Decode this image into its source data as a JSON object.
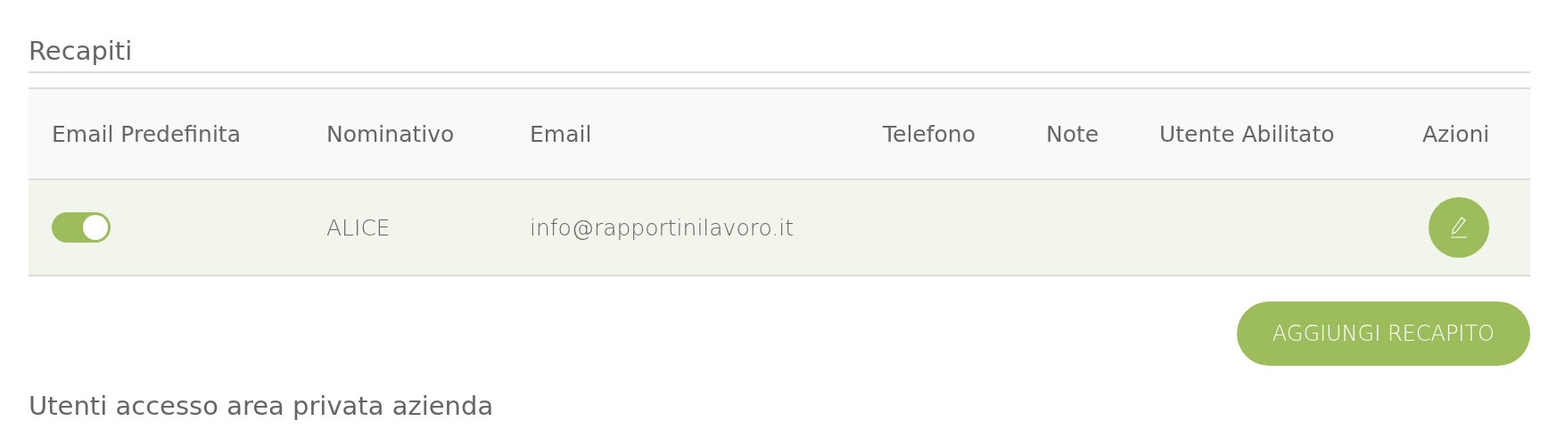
{
  "section_title": "Recapiti",
  "table": {
    "columns": [
      "Email Predefinita",
      "Nominativo",
      "Email",
      "Telefono",
      "Note",
      "Utente Abilitato",
      "Azioni"
    ],
    "rows": [
      {
        "default_email_on": true,
        "nominativo": "ALICE",
        "email": "info@rapportinilavoro.it",
        "selected": true
      }
    ]
  },
  "add_button": "AGGIUNGI RECAPITO",
  "next_section_title": "Utenti accesso area privata azienda"
}
